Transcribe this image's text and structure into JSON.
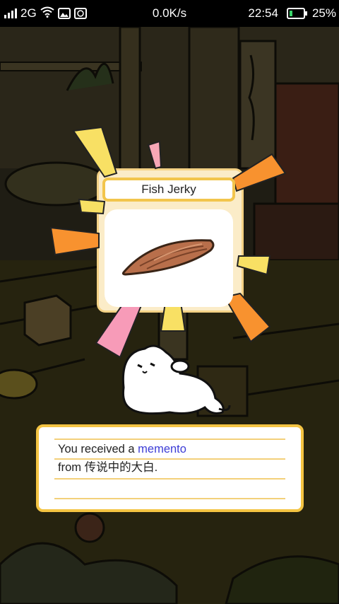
{
  "status_bar": {
    "network": "2G",
    "speed": "0.0K/s",
    "time": "22:54",
    "battery": "25%",
    "battery_level": 0.25
  },
  "item": {
    "name": "Fish Jerky",
    "icon": "fish-jerky-icon"
  },
  "message": {
    "prefix": "You received a",
    "highlight": "memento",
    "line2": "from 传说中的大白.",
    "highlight_color": "#3d3dd6"
  }
}
